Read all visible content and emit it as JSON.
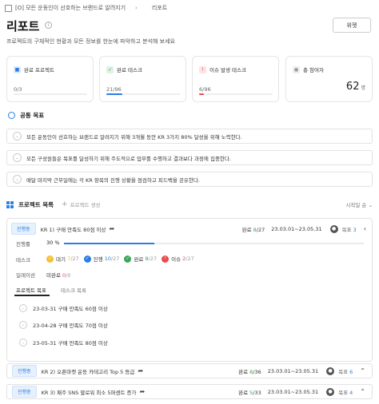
{
  "breadcrumb": {
    "item1": "[O] 모든 운동인이 선호하는 브랜드로 알려지기",
    "item2": "리포트"
  },
  "page": {
    "title": "리포트",
    "description": "프로젝트의 구체적인 현황과 모든 정보를 한눈에 파악하고 분석해 보세요",
    "view_button": "위젯"
  },
  "cards": {
    "completed_projects": {
      "label": "완료 프로젝트",
      "count": "0/3",
      "ratio": 0.0
    },
    "completed_tasks": {
      "label": "완료 테스크",
      "count": "21/96",
      "ratio": 0.22
    },
    "issue_tasks": {
      "label": "이슈 발생 테스크",
      "count": "6/96",
      "ratio": 0.06
    },
    "participants": {
      "label": "총 참여자",
      "value": "62",
      "unit": "명"
    }
  },
  "colors": {
    "accent": "#2b7de1",
    "projects": "#7fb8ef",
    "tasks": "#7dcf92",
    "issues": "#f29a9a",
    "waiting": "#f2c230",
    "progress": "#2b7de1",
    "done": "#3aa757",
    "issue": "#e84b4b"
  },
  "common_goals": {
    "header": "공통 목표",
    "items": [
      "모든 운동인이 선호하는 브랜드로 알려지기 위해 3개월 동안 KR 3가지 80% 달성을 위해 노력한다.",
      "모든 구성원들은 목표를 달성하기 위해 주도적으로 업무를 수행하고 결과보다 과정에 집중한다.",
      "매달 마지막 근무일에는 각 KR 항목의 진행 상황을 점검하고 피드백을 공유한다."
    ]
  },
  "projects": {
    "header": "프로젝트 목록",
    "add_label": "프로젝트 생성",
    "sort_label": "시작일 순",
    "rows": [
      {
        "status": "진행중",
        "title": "KR 1) 구매 만족도 80점 이상",
        "done_label": "완료",
        "done": "8",
        "total": "/27",
        "dates": "23.03.01~23.05.31",
        "target_label": "목표",
        "target": "3"
      },
      {
        "status": "진행중",
        "title": "KR 2) 오픈마켓 운동 카테고리 Top 5 등급",
        "done_label": "완료",
        "done": "8",
        "total": "/36",
        "dates": "23.03.01~23.05.31",
        "target_label": "목표",
        "target": "6"
      },
      {
        "status": "진행중",
        "title": "KR 3) 패주 SNS 팔로워 최소 5퍼센트 증가",
        "done_label": "완료",
        "done": "5",
        "total": "/33",
        "dates": "23.03.01~23.05.31",
        "target_label": "목표",
        "target": "4"
      }
    ]
  },
  "detail": {
    "progress_label": "진행률",
    "progress_value": "30 %",
    "progress_ratio": 0.3,
    "task_label": "테스크",
    "tasks": {
      "waiting": {
        "label": "대기",
        "value": "7",
        "total": "/27"
      },
      "progress": {
        "label": "진행",
        "value": "10",
        "total": "/27"
      },
      "done": {
        "label": "완료",
        "value": "8",
        "total": "/27"
      },
      "issue": {
        "label": "이슈",
        "value": "2",
        "total": "/27"
      }
    },
    "milestone_label": "일레이션",
    "milestone_value": "미완료",
    "milestone_count": "0",
    "milestone_total": "/0",
    "tabs": [
      "프로젝트 목표",
      "테스크 목록"
    ],
    "goals": [
      "23-03-31 구매 만족도 60점 이상",
      "23-04-28 구매 만족도 70점 이상",
      "23-05-31 구매 만족도 80점 이상"
    ]
  }
}
